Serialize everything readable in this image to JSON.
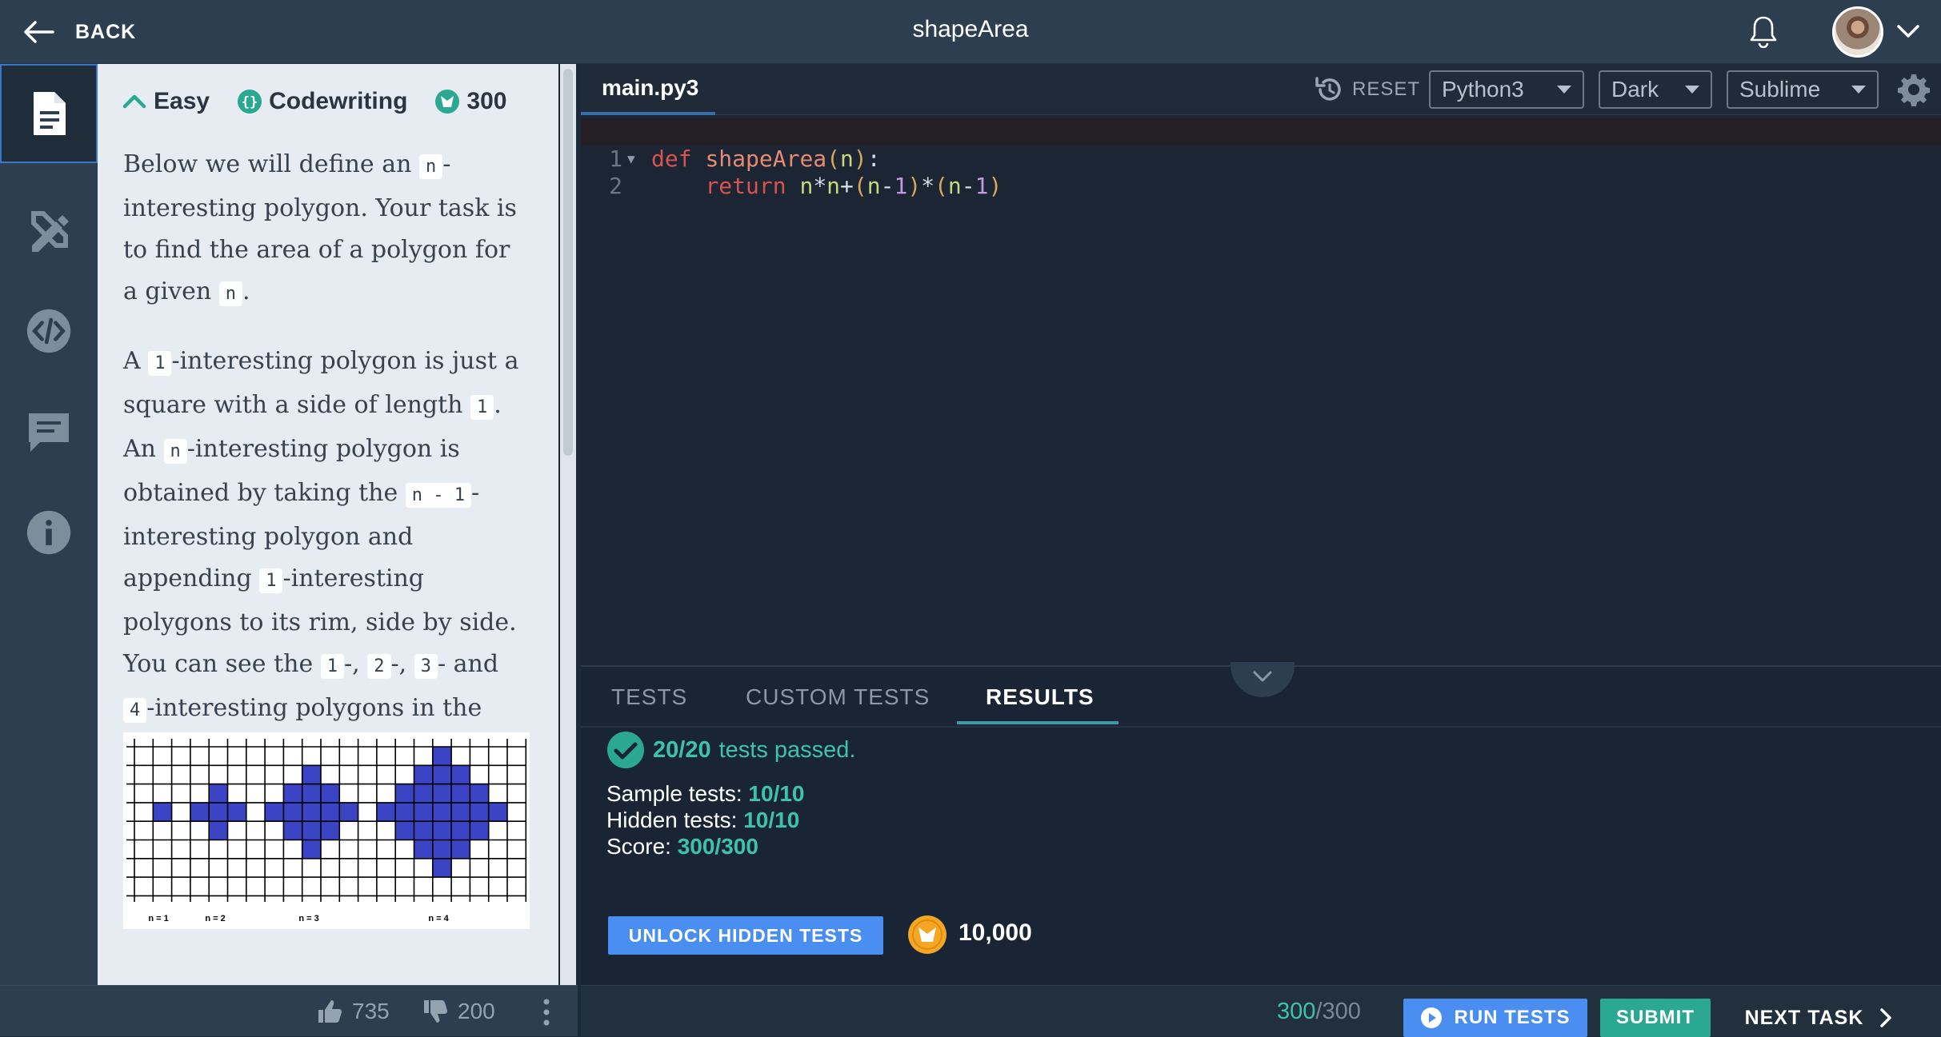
{
  "header": {
    "back_label": "BACK",
    "title": "shapeArea"
  },
  "sidebar": {
    "items": [
      {
        "name": "description",
        "icon": "document-icon",
        "active": true
      },
      {
        "name": "solutions",
        "icon": "pencil-ruler-icon",
        "active": false
      },
      {
        "name": "code",
        "icon": "code-brackets-icon",
        "active": false
      },
      {
        "name": "comments",
        "icon": "chat-icon",
        "active": false
      },
      {
        "name": "info",
        "icon": "info-icon",
        "active": false
      }
    ]
  },
  "task": {
    "difficulty": "Easy",
    "type": "Codewriting",
    "points": "300",
    "p1_a": "Below we will define an ",
    "p1_code1": "n",
    "p1_b": "-interesting polygon. Your task is to find the area of a polygon for a given ",
    "p1_code2": "n",
    "p1_c": ".",
    "p2_a": "A ",
    "p2_code1": "1",
    "p2_b": "-interesting polygon is just a square with a side of length ",
    "p2_code2": "1",
    "p2_c": ". An ",
    "p2_code3": "n",
    "p2_d": "-interesting polygon is obtained by taking the ",
    "p2_code4": "n - 1",
    "p2_e": "-interesting polygon and appending ",
    "p2_code5": "1",
    "p2_f": "-interesting polygons to its rim, side by side. You can see the ",
    "p2_code6": "1",
    "p2_g": "-, ",
    "p2_code7": "2",
    "p2_h": "-, ",
    "p2_code8": "3",
    "p2_i": "- and ",
    "p2_code9": "4",
    "p2_j": "-interesting polygons in the picture below.",
    "picture_labels": [
      "n = 1",
      "n = 2",
      "n = 3",
      "n = 4"
    ]
  },
  "votes": {
    "up": "735",
    "down": "200"
  },
  "editor": {
    "file_tab": "main.py3",
    "reset_label": "RESET",
    "language": "Python3",
    "theme": "Dark",
    "keymap": "Sublime",
    "line_numbers": [
      "1",
      "2"
    ]
  },
  "results": {
    "tabs": [
      "TESTS",
      "CUSTOM TESTS",
      "RESULTS"
    ],
    "passed_count": "20/20",
    "passed_text": "tests passed.",
    "sample_label": "Sample tests:",
    "sample_value": "10/10",
    "hidden_label": "Hidden tests:",
    "hidden_value": "10/10",
    "score_label": "Score:",
    "score_value": "300/300",
    "unlock_label": "UNLOCK HIDDEN TESTS",
    "coin_cost": "10,000"
  },
  "footer": {
    "score_earned": "300",
    "score_total": "/300",
    "run_label": "RUN TESTS",
    "submit_label": "SUBMIT",
    "next_label": "NEXT TASK"
  },
  "colors": {
    "accent_blue": "#4a8ef2",
    "success_teal": "#3ec2b0",
    "shape_fill": "#3a44c4"
  }
}
